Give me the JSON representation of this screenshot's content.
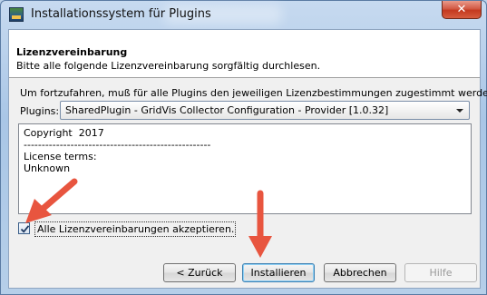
{
  "window": {
    "title": "Installationssystem für Plugins",
    "close_glyph": "✕"
  },
  "header": {
    "title": "Lizenzvereinbarung",
    "subtitle": "Bitte alle folgende Lizenzvereinbarung sorgfältig durchlesen."
  },
  "main": {
    "info": "Um fortzufahren, muß für alle Plugins den jeweiligen Lizenzbestimmungen zugestimmt werden.",
    "plugins_label": "Plugins:",
    "plugins_selected": "SharedPlugin - GridVis Collector Configuration - Provider [1.0.32]",
    "license_lines": [
      "Copyright  2017",
      "----------------------------------------------------",
      "License terms:",
      "Unknown"
    ],
    "accept_label": "Alle Lizenzvereinbarungen akzeptieren.",
    "accept_checked": true
  },
  "buttons": {
    "back": "< Zurück",
    "install": "Installieren",
    "cancel": "Abbrechen",
    "help": "Hilfe"
  },
  "colors": {
    "annotation_arrow": "#e8553f"
  }
}
